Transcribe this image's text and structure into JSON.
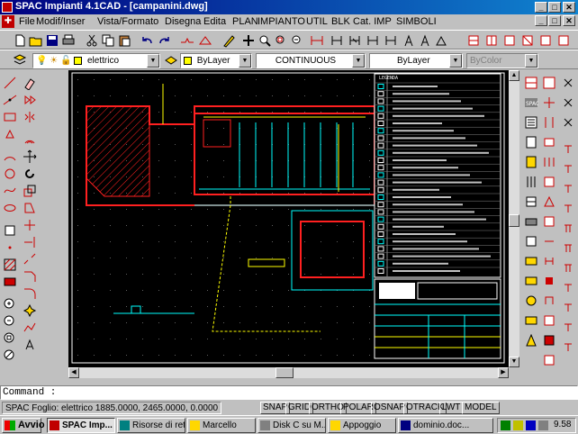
{
  "window": {
    "title": "SPAC Impianti 4.1CAD - [campanini.dwg]",
    "min_label": "_",
    "max_label": "□",
    "close_label": "✕"
  },
  "menu": {
    "items": [
      "File",
      "Modif/Inser",
      "Vista/Formato",
      "Disegna",
      "Edita",
      "PLAN",
      "IMPIANTO",
      "UTIL",
      "BLK",
      "Cat. IMP",
      "SIMBOLI"
    ]
  },
  "layers_toolbar": {
    "layer_name": "elettrico",
    "color": "ByLayer",
    "linetype": "CONTINUOUS",
    "lineweight": "ByLayer",
    "plotstyle": "ByColor"
  },
  "command": {
    "prompt": "Command :",
    "value": ""
  },
  "status": {
    "coords_text": "SPAC Foglio: elettrico  1885.0000, 2465.0000, 0.0000",
    "toggles": [
      "SNAP",
      "GRID",
      "ORTHO",
      "POLAR",
      "OSNAP",
      "OTRACK",
      "LWT",
      "MODEL"
    ]
  },
  "taskbar": {
    "start_label": "Avvio",
    "tasks": [
      "SPAC Imp...",
      "Risorse di rete",
      "Marcello",
      "Disk C su M...",
      "Appoggio",
      "dominio.doc..."
    ],
    "active_task": 0,
    "clock": "9.58"
  },
  "drawing": {
    "background": "#000000",
    "wall_color": "#ff2020",
    "wire_color": "#ffff00",
    "aux_color": "#00ffff",
    "grid_color": "#606060",
    "legend_title": "LEGENDA"
  }
}
